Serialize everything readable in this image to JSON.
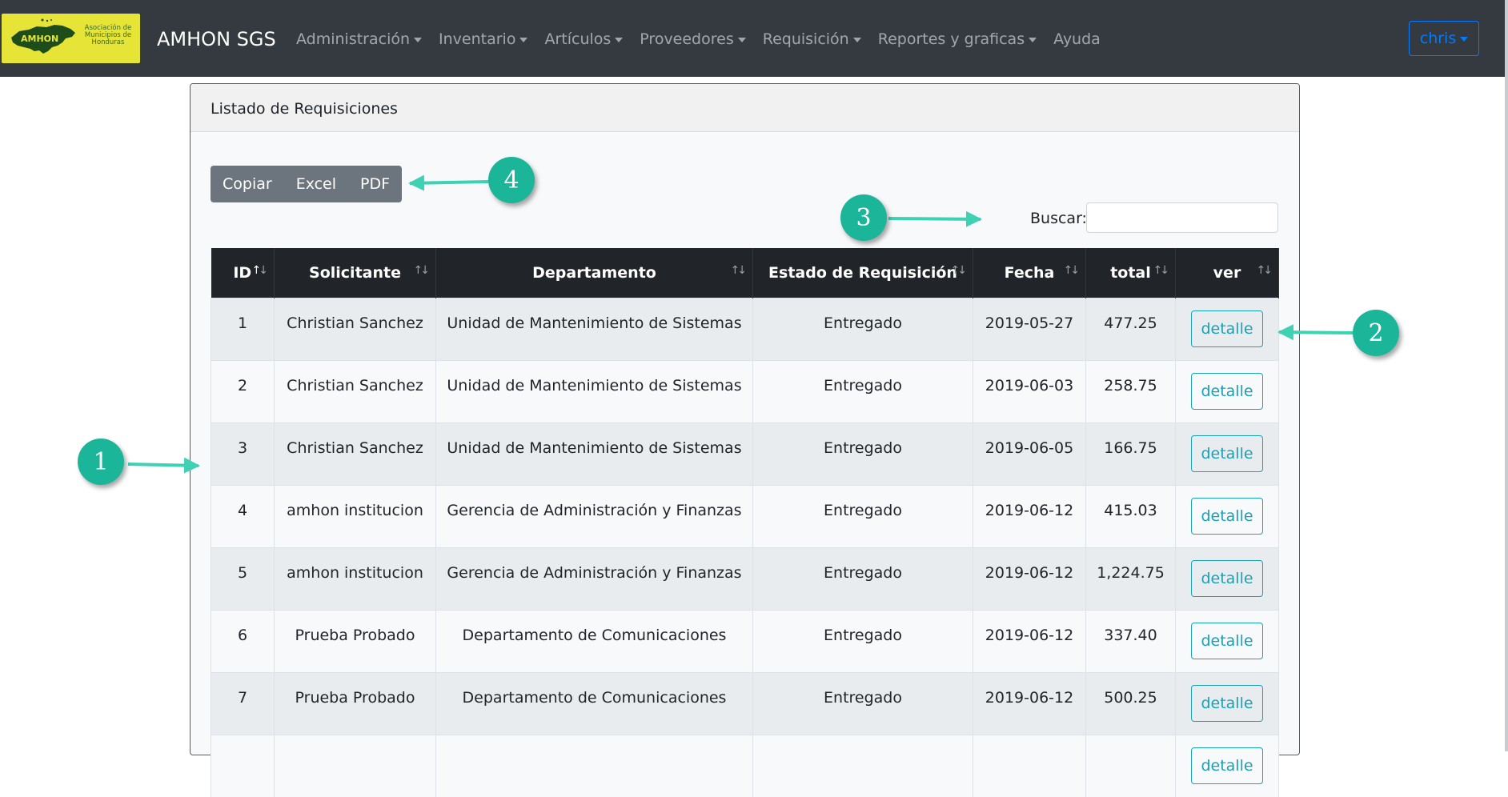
{
  "navbar": {
    "logo_text": "Asociación de Municipios de Honduras",
    "logo_map_label": "AMHON",
    "brand": "AMHON SGS",
    "menu": [
      {
        "label": "Administración",
        "dropdown": true
      },
      {
        "label": "Inventario",
        "dropdown": true
      },
      {
        "label": "Artículos",
        "dropdown": true
      },
      {
        "label": "Proveedores",
        "dropdown": true
      },
      {
        "label": "Requisición",
        "dropdown": true
      },
      {
        "label": "Reportes y graficas",
        "dropdown": true
      },
      {
        "label": "Ayuda",
        "dropdown": false
      }
    ],
    "user": "chris"
  },
  "card": {
    "title": "Listado de Requisiciones"
  },
  "export_buttons": {
    "copy": "Copiar",
    "excel": "Excel",
    "pdf": "PDF"
  },
  "search": {
    "label": "Buscar:",
    "value": ""
  },
  "table": {
    "columns": [
      "ID",
      "Solicitante",
      "Departamento",
      "Estado de Requisición",
      "Fecha",
      "total",
      "ver"
    ],
    "sorted_column": "ID",
    "sort_direction": "ascending",
    "rows": [
      {
        "id": "1",
        "solicitante": "Christian Sanchez",
        "departamento": "Unidad de Mantenimiento de Sistemas",
        "estado": "Entregado",
        "fecha": "2019-05-27",
        "total": "477.25",
        "ver": "detalle"
      },
      {
        "id": "2",
        "solicitante": "Christian Sanchez",
        "departamento": "Unidad de Mantenimiento de Sistemas",
        "estado": "Entregado",
        "fecha": "2019-06-03",
        "total": "258.75",
        "ver": "detalle"
      },
      {
        "id": "3",
        "solicitante": "Christian Sanchez",
        "departamento": "Unidad de Mantenimiento de Sistemas",
        "estado": "Entregado",
        "fecha": "2019-06-05",
        "total": "166.75",
        "ver": "detalle"
      },
      {
        "id": "4",
        "solicitante": "amhon institucion",
        "departamento": "Gerencia de Administración y Finanzas",
        "estado": "Entregado",
        "fecha": "2019-06-12",
        "total": "415.03",
        "ver": "detalle"
      },
      {
        "id": "5",
        "solicitante": "amhon institucion",
        "departamento": "Gerencia de Administración y Finanzas",
        "estado": "Entregado",
        "fecha": "2019-06-12",
        "total": "1,224.75",
        "ver": "detalle"
      },
      {
        "id": "6",
        "solicitante": "Prueba Probado",
        "departamento": "Departamento de Comunicaciones",
        "estado": "Entregado",
        "fecha": "2019-06-12",
        "total": "337.40",
        "ver": "detalle"
      },
      {
        "id": "7",
        "solicitante": "Prueba Probado",
        "departamento": "Departamento de Comunicaciones",
        "estado": "Entregado",
        "fecha": "2019-06-12",
        "total": "500.25",
        "ver": "detalle"
      },
      {
        "id": "",
        "solicitante": "",
        "departamento": "",
        "estado": "",
        "fecha": "",
        "total": "",
        "ver": "detalle"
      }
    ]
  },
  "annotations": {
    "markers": [
      "1",
      "2",
      "3",
      "4"
    ],
    "color": "#1bb59a"
  },
  "colors": {
    "navbar_bg": "#343a40",
    "logo_bg": "#e6e436",
    "primary": "#007bff",
    "info": "#17a2b8",
    "secondary": "#6c757d",
    "table_head": "#212529"
  }
}
